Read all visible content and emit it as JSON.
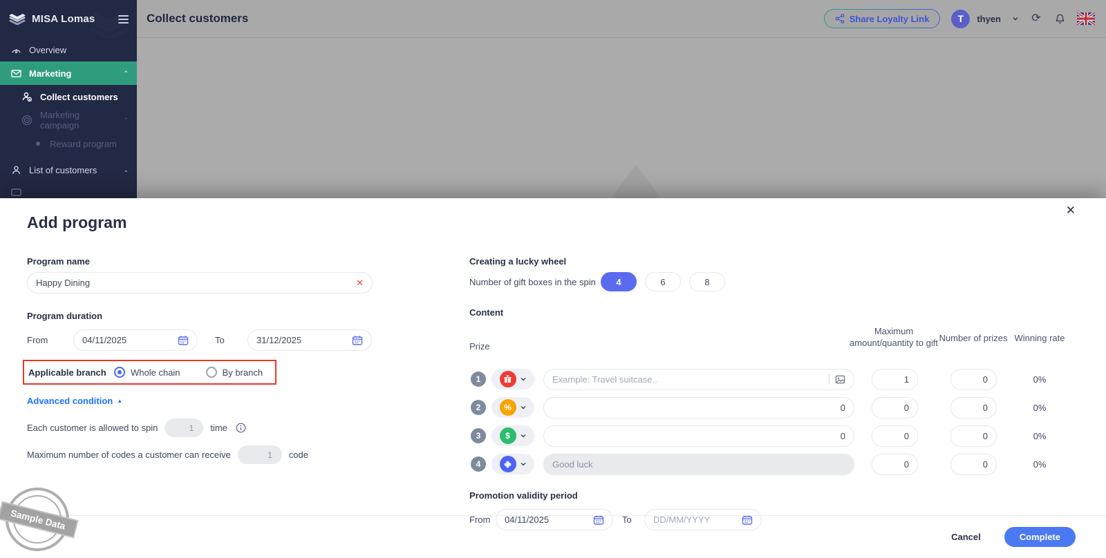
{
  "brand": {
    "name": "MISA Lomas"
  },
  "header": {
    "title": "Collect customers",
    "share_button": "Share Loyalty Link",
    "user": {
      "initial": "T",
      "name": "thyen"
    }
  },
  "sidebar": {
    "items": [
      {
        "label": "Overview"
      },
      {
        "label": "Marketing"
      },
      {
        "label": "Collect customers"
      },
      {
        "label": "Marketing campaign"
      },
      {
        "label": "Reward program"
      },
      {
        "label": "List of customers"
      }
    ]
  },
  "modal": {
    "title": "Add program",
    "close_icon": "✕",
    "program_name": {
      "label": "Program name",
      "value": "Happy Dining",
      "clear_icon": "✕"
    },
    "duration": {
      "label": "Program duration",
      "from_label": "From",
      "from_value": "04/11/2025",
      "to_label": "To",
      "to_value": "31/12/2025"
    },
    "branch": {
      "label": "Applicable branch",
      "options": [
        {
          "label": "Whole chain",
          "selected": true
        },
        {
          "label": "By branch",
          "selected": false
        }
      ]
    },
    "advanced": {
      "label": "Advanced condition",
      "collapse_icon": "▲",
      "spin": {
        "prefix": "Each customer is allowed to spin",
        "value": "1",
        "suffix": "time"
      },
      "codes": {
        "prefix": "Maximum number of codes a customer can receive",
        "value": "1",
        "suffix": "code"
      }
    },
    "wheel": {
      "title": "Creating a lucky wheel",
      "gift_boxes_label": "Number of gift boxes in the spin",
      "options": [
        "4",
        "6",
        "8"
      ],
      "selected": "4"
    },
    "content": {
      "title": "Content",
      "columns": {
        "prize": "Prize",
        "max": "Maximum amount/quantity to gift",
        "number": "Number of prizes",
        "rate": "Winning rate"
      },
      "rows": [
        {
          "index": "1",
          "icon": "gift",
          "placeholder": "Example: Travel suitcase..",
          "value": "",
          "max": "1",
          "number": "0",
          "rate": "0%"
        },
        {
          "index": "2",
          "icon": "percent",
          "icon_glyph": "%",
          "value": "0",
          "max": "0",
          "number": "0",
          "rate": "0%"
        },
        {
          "index": "3",
          "icon": "dollar",
          "icon_glyph": "$",
          "value": "0",
          "max": "0",
          "number": "0",
          "rate": "0%"
        },
        {
          "index": "4",
          "icon": "clover",
          "value": "Good luck",
          "max": "0",
          "number": "0",
          "rate": "0%",
          "disabled": true
        }
      ]
    },
    "promotion": {
      "label": "Promotion validity period",
      "from_label": "From",
      "from_value": "04/11/2025",
      "to_label": "To",
      "to_placeholder": "DD/MM/YYYY"
    },
    "footer": {
      "cancel": "Cancel",
      "complete": "Complete"
    }
  },
  "watermark": {
    "text": "Sample Data"
  },
  "colors": {
    "navy": "#222944",
    "sidebar_active_green": "#2f9d7d",
    "accent_indigo": "#5b6bf0",
    "complete_blue": "#4a79f2",
    "link_blue": "#1f72ff",
    "highlight_red": "#e8382a",
    "prize_red": "#ef3b36",
    "prize_orange": "#f7a400",
    "prize_green": "#2cbd6e",
    "prize_blue": "#4d63f7"
  }
}
